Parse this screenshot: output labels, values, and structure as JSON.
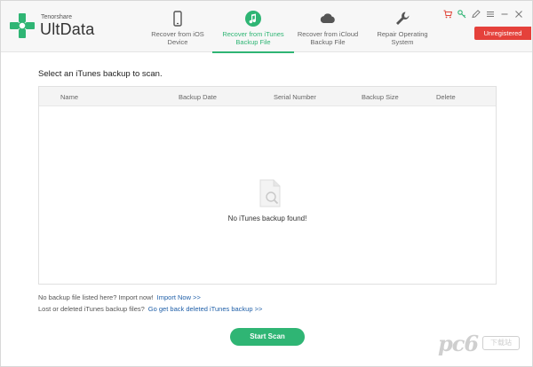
{
  "app": {
    "brand_small": "Tenorshare",
    "brand_name": "UltData"
  },
  "nav": {
    "ios": "Recover from iOS\nDevice",
    "itunes": "Recover from iTunes\nBackup File",
    "icloud": "Recover from iCloud\nBackup File",
    "repair": "Repair Operating\nSystem"
  },
  "window_controls": [
    "cart-icon",
    "key-icon",
    "feedback-icon",
    "menu-icon",
    "minimize-icon",
    "close-icon"
  ],
  "badge": {
    "label": "Unregistered",
    "color": "#e5413b"
  },
  "main": {
    "prompt": "Select an iTunes backup to scan.",
    "columns": [
      "Name",
      "Backup Date",
      "Serial Number",
      "Backup Size",
      "Delete"
    ],
    "empty_text": "No iTunes backup found!"
  },
  "hints": {
    "line1_text": "No backup file listed here? Import now!",
    "line1_link": "Import Now >>",
    "line2_text": "Lost or deleted iTunes backup files?",
    "line2_link": "Go get back deleted iTunes backup >>"
  },
  "actions": {
    "start_scan": "Start Scan"
  },
  "colors": {
    "accent": "#2fb574",
    "link": "#1f5fa8"
  },
  "watermark": {
    "text": "pc6",
    "box": "下载站"
  }
}
